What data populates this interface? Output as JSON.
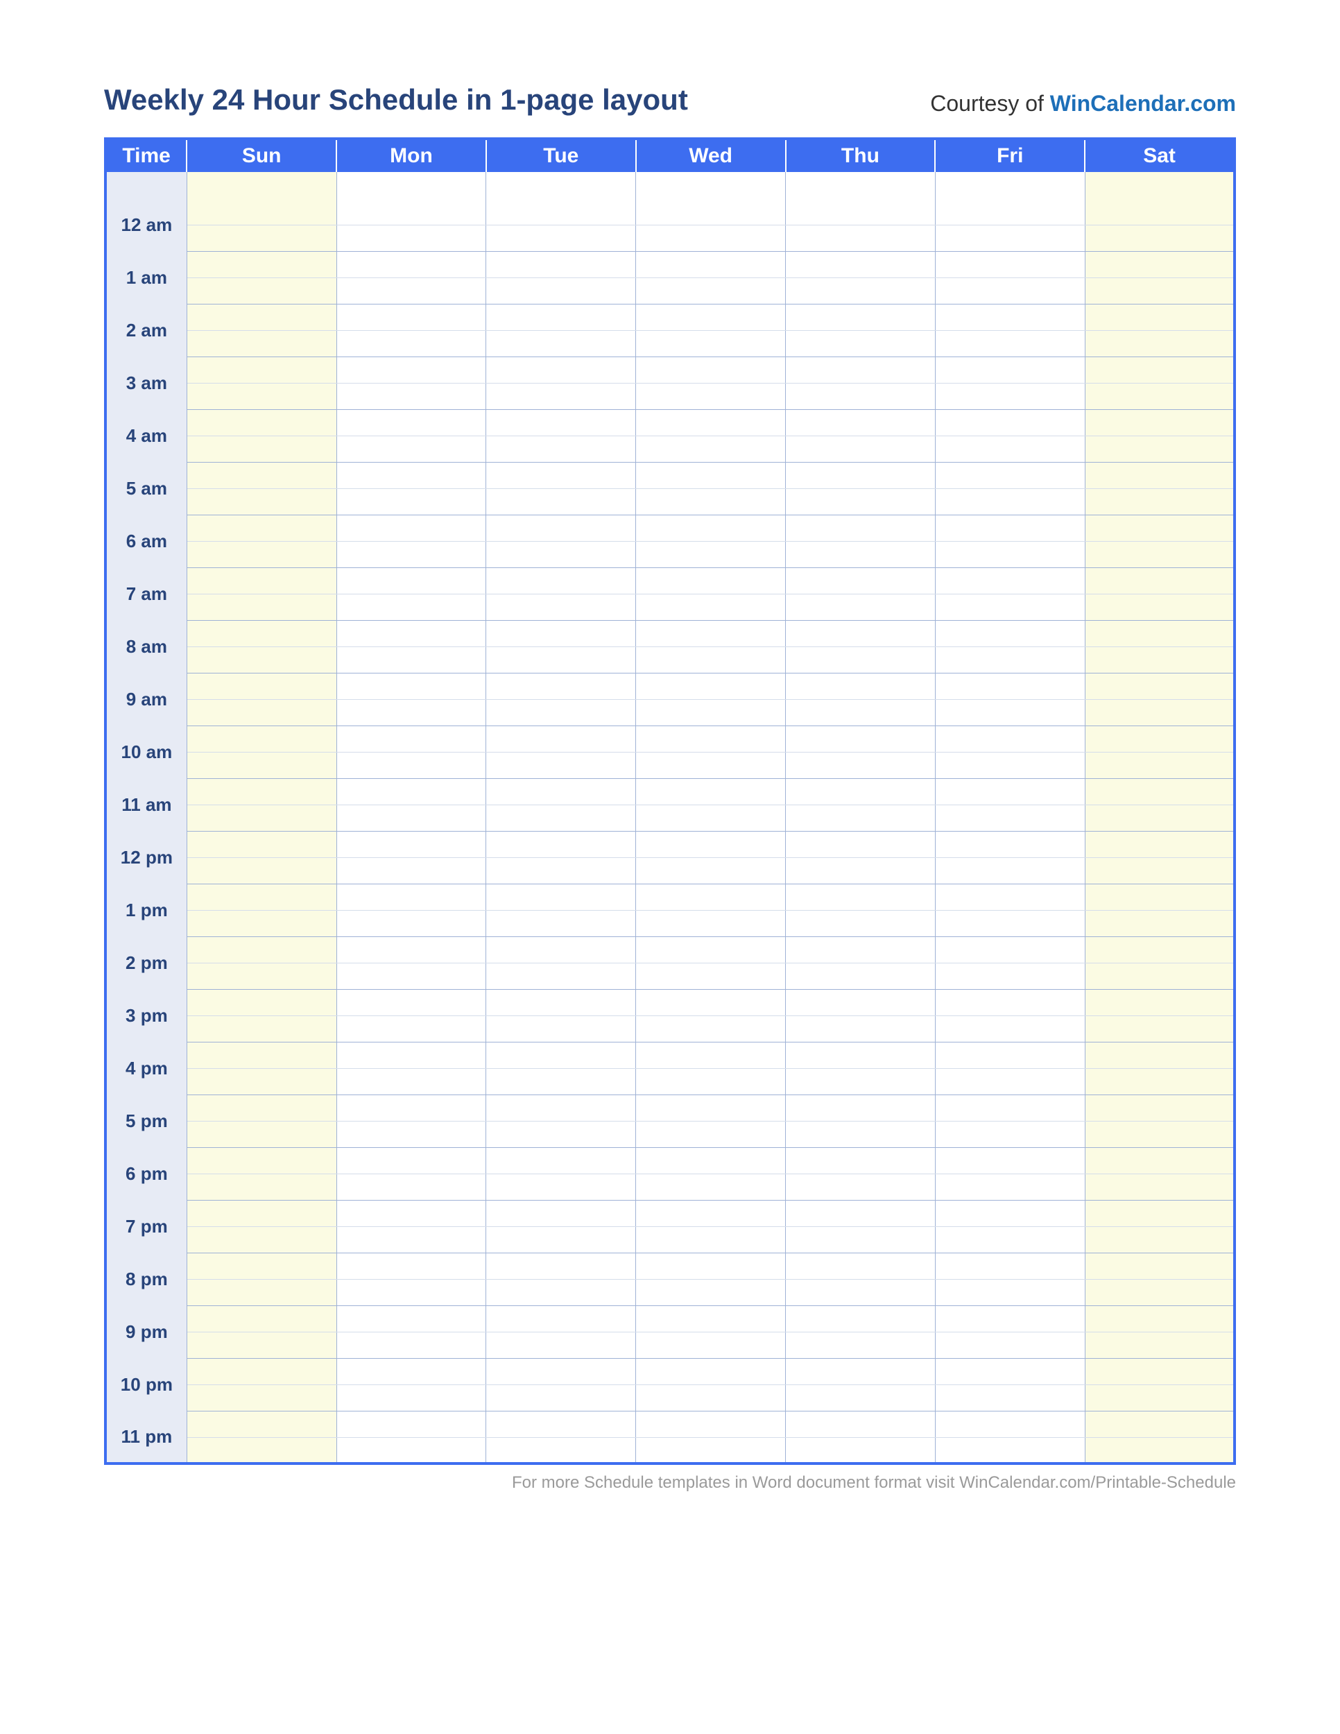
{
  "header": {
    "title": "Weekly 24 Hour Schedule in 1-page layout",
    "courtesy_prefix": "Courtesy of ",
    "courtesy_link": "WinCalendar.com"
  },
  "columns": {
    "time": "Time",
    "days": [
      "Sun",
      "Mon",
      "Tue",
      "Wed",
      "Thu",
      "Fri",
      "Sat"
    ]
  },
  "hours": [
    "12 am",
    "1 am",
    "2 am",
    "3 am",
    "4 am",
    "5 am",
    "6 am",
    "7 am",
    "8 am",
    "9 am",
    "10 am",
    "11 am",
    "12 pm",
    "1 pm",
    "2 pm",
    "3 pm",
    "4 pm",
    "5 pm",
    "6 pm",
    "7 pm",
    "8 pm",
    "9 pm",
    "10 pm",
    "11 pm"
  ],
  "footer": {
    "prefix": "For more Schedule templates in Word document format visit ",
    "link": "WinCalendar.com/Printable-Schedule"
  }
}
